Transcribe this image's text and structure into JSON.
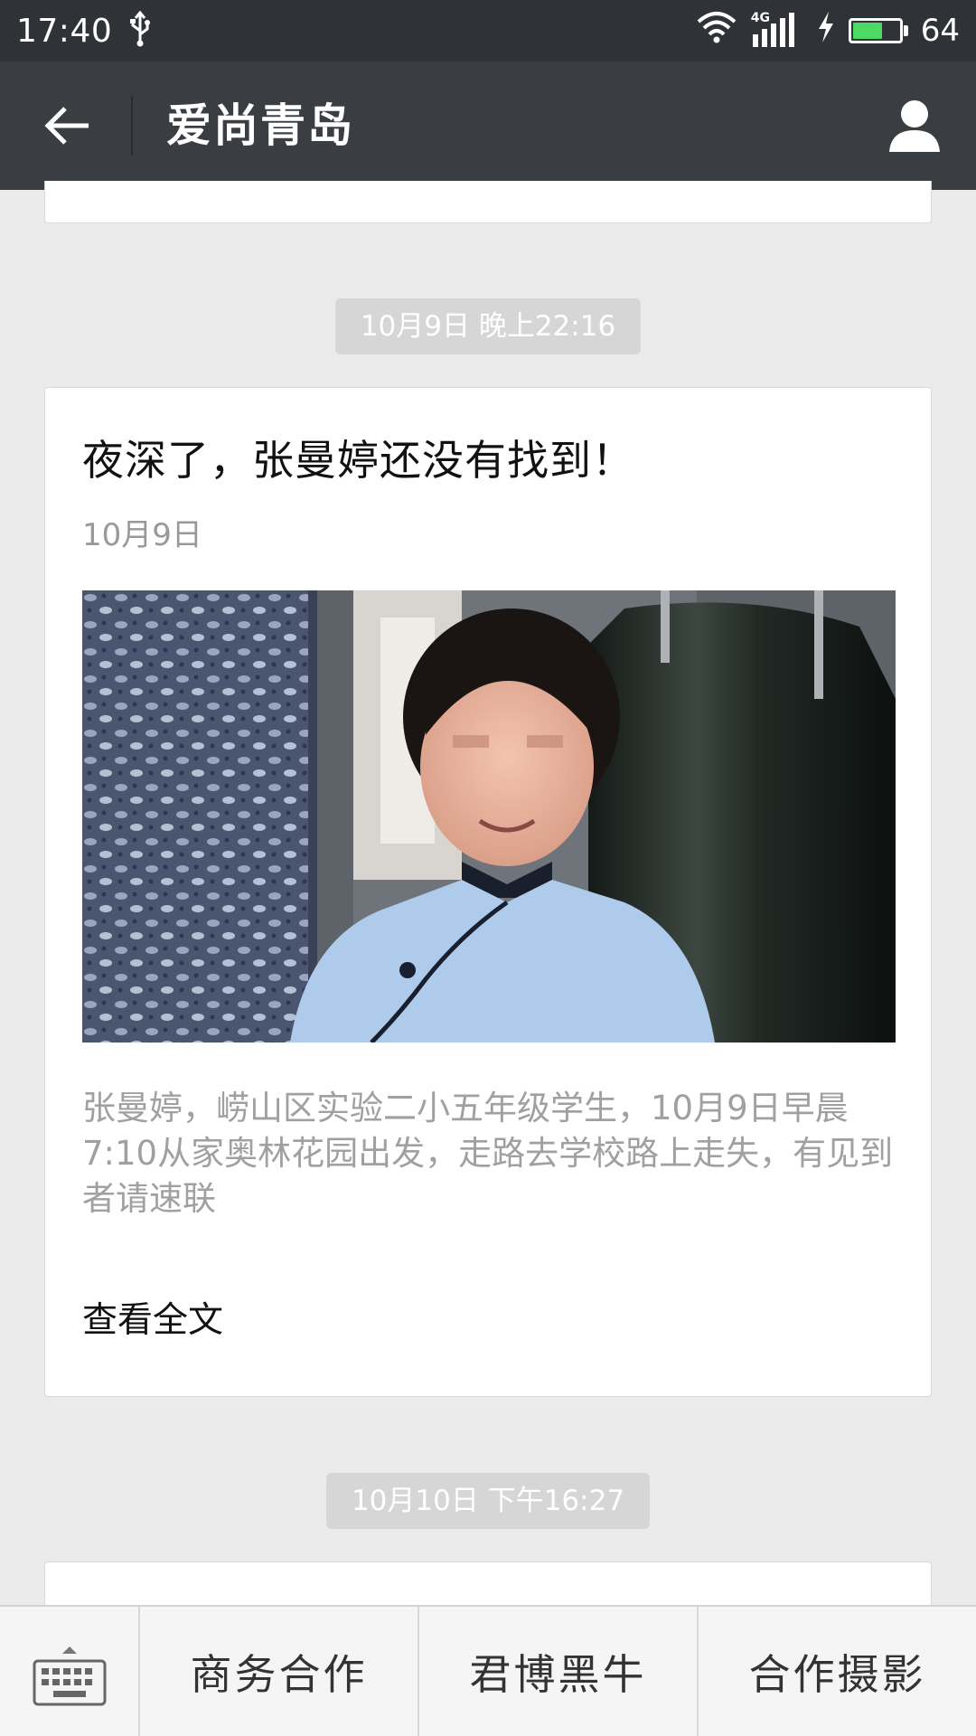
{
  "status_bar": {
    "time": "17:40",
    "network": "4G",
    "battery": "64",
    "battery_level": 0.64,
    "icons": [
      "usb-icon",
      "wifi-icon",
      "signal-icon",
      "charging-icon",
      "battery-icon"
    ]
  },
  "header": {
    "title": "爱尚青岛",
    "back_icon": "arrow-left-icon",
    "profile_icon": "person-icon"
  },
  "messages": [
    {
      "timestamp": "10月9日 晚上22:16",
      "article": {
        "title": "夜深了，张曼婷还没有找到！",
        "date": "10月9日",
        "summary": "张曼婷，崂山区实验二小五年级学生，10月9日早晨7:10从家奥林花园出发，走路去学校路上走失，有见到者请速联",
        "read_more": "查看全文"
      }
    },
    {
      "timestamp": "10月10日 下午16:27"
    }
  ],
  "bottom_menu": {
    "keyboard_icon": "keyboard-icon",
    "items": [
      "商务合作",
      "君博黑牛",
      "合作摄影"
    ]
  },
  "colors": {
    "status_bar": "#2f3236",
    "title_bar": "#3a3d41",
    "background": "#ebebeb",
    "timestamp_bg": "#d6d6d6",
    "battery": "#4cd964"
  }
}
